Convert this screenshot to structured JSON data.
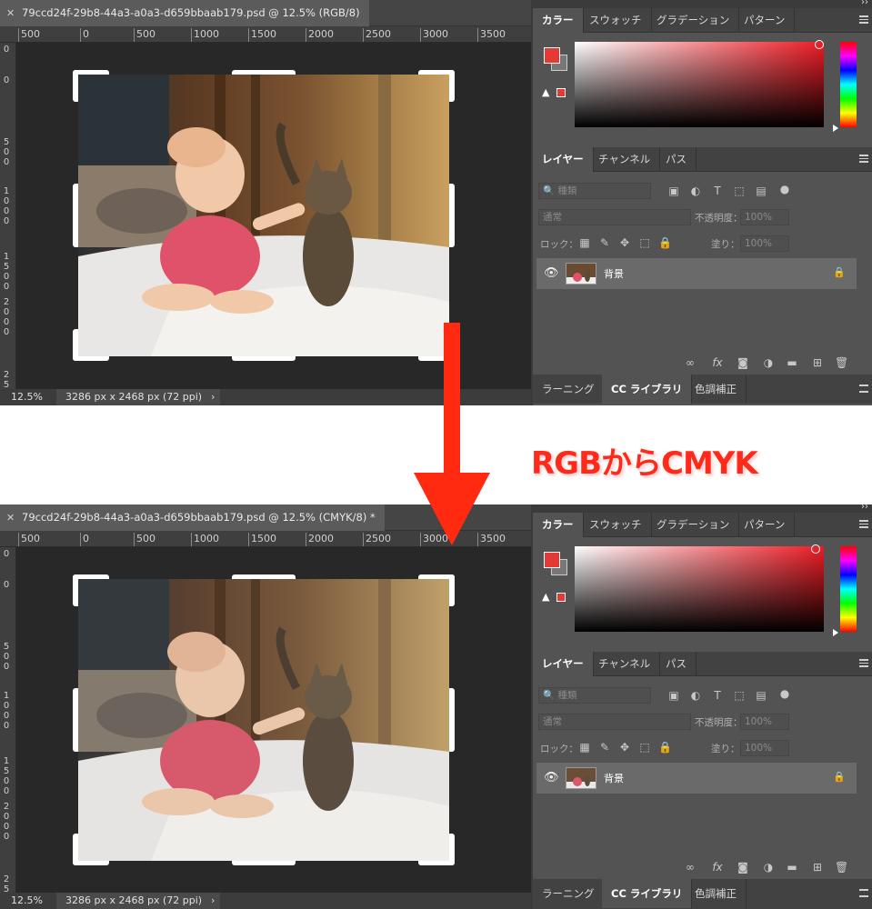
{
  "panels": [
    {
      "doc_tab": "79ccd24f-29b8-44a3-a0a3-d659bbaab179.psd @ 12.5% (RGB/8)",
      "zoom": "12.5%",
      "doc_info": "3286 px x 2468 px (72 ppi)"
    },
    {
      "doc_tab": "79ccd24f-29b8-44a3-a0a3-d659bbaab179.psd @ 12.5% (CMYK/8) *",
      "zoom": "12.5%",
      "doc_info": "3286 px x 2468 px (72 ppi)"
    }
  ],
  "ruler_h": [
    "500",
    "0",
    "500",
    "1000",
    "1500",
    "2000",
    "2500",
    "3000",
    "3500"
  ],
  "ruler_v_top": [
    "0",
    "0",
    "5",
    "0",
    "0",
    "1",
    "0",
    "0",
    "0",
    "1",
    "5",
    "0",
    "0",
    "2",
    "0",
    "0",
    "0",
    "2",
    "5"
  ],
  "ruler_v_bot": [
    "0",
    "0",
    "5",
    "0",
    "0",
    "1",
    "0",
    "0",
    "0",
    "1",
    "5",
    "0",
    "0",
    "2",
    "0",
    "0",
    "0",
    "2",
    "5"
  ],
  "color_tabs": [
    "カラー",
    "スウォッチ",
    "グラデーション",
    "パターン"
  ],
  "layer_tabs": [
    "レイヤー",
    "チャンネル",
    "パス"
  ],
  "layer_search": "種類",
  "blend_mode": "通常",
  "opacity_label": "不透明度：",
  "opacity_value": "100%",
  "lock_label": "ロック：",
  "fill_label": "塗り：",
  "fill_value": "100%",
  "layer_name": "背景",
  "bottom_tabs": [
    "ラーニング",
    "CC ライブラリ",
    "色調補正"
  ],
  "caption": "RGBからCMYK",
  "colors": {
    "accent": "#e53935",
    "caption": "#ff2a1a"
  }
}
